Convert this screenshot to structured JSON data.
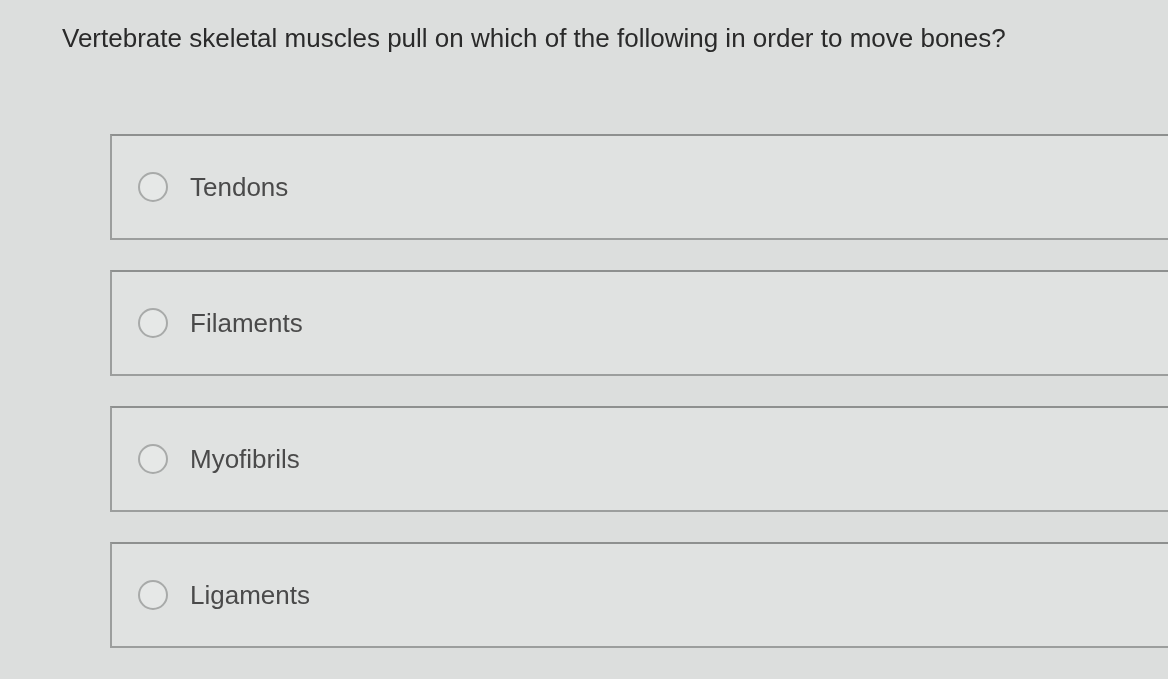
{
  "question": {
    "text": "Vertebrate skeletal muscles pull on which of the following in order to move bones?"
  },
  "options": [
    {
      "label": "Tendons",
      "selected": false
    },
    {
      "label": "Filaments",
      "selected": false
    },
    {
      "label": "Myofibrils",
      "selected": false
    },
    {
      "label": "Ligaments",
      "selected": false
    }
  ]
}
